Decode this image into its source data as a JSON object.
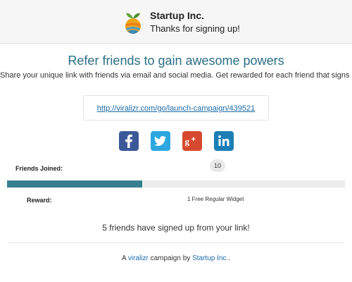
{
  "header": {
    "company_name": "Startup Inc.",
    "subtitle": "Thanks for signing up!"
  },
  "main": {
    "headline": "Refer friends to gain awesome powers",
    "description": "Share your unique link with friends via email and social media. Get rewarded for each friend that signs up.",
    "referral_link": "http://viralizr.com/go/launch-campaign/439521"
  },
  "social": [
    {
      "name": "facebook-icon",
      "color": "#3b5998"
    },
    {
      "name": "twitter-icon",
      "color": "#2ca7e0"
    },
    {
      "name": "google-plus-icon",
      "color": "#d6492f"
    },
    {
      "name": "linkedin-icon",
      "color": "#1b7fb5"
    }
  ],
  "progress": {
    "label": "Friends Joined:",
    "goal": "10",
    "fraction": 0.4,
    "accent_color": "#357f8e"
  },
  "reward": {
    "label": "Reward:",
    "value": "1 Free Regular Widget"
  },
  "status_text": "5 friends have signed up from your link!",
  "footer": {
    "prefix": "A ",
    "brand_link": "viralizr",
    "middle": " campaign by ",
    "company_link": "Startup Inc.",
    "suffix": "."
  },
  "colors": {
    "headline": "#2a6f86",
    "link": "#1a6aa8"
  }
}
